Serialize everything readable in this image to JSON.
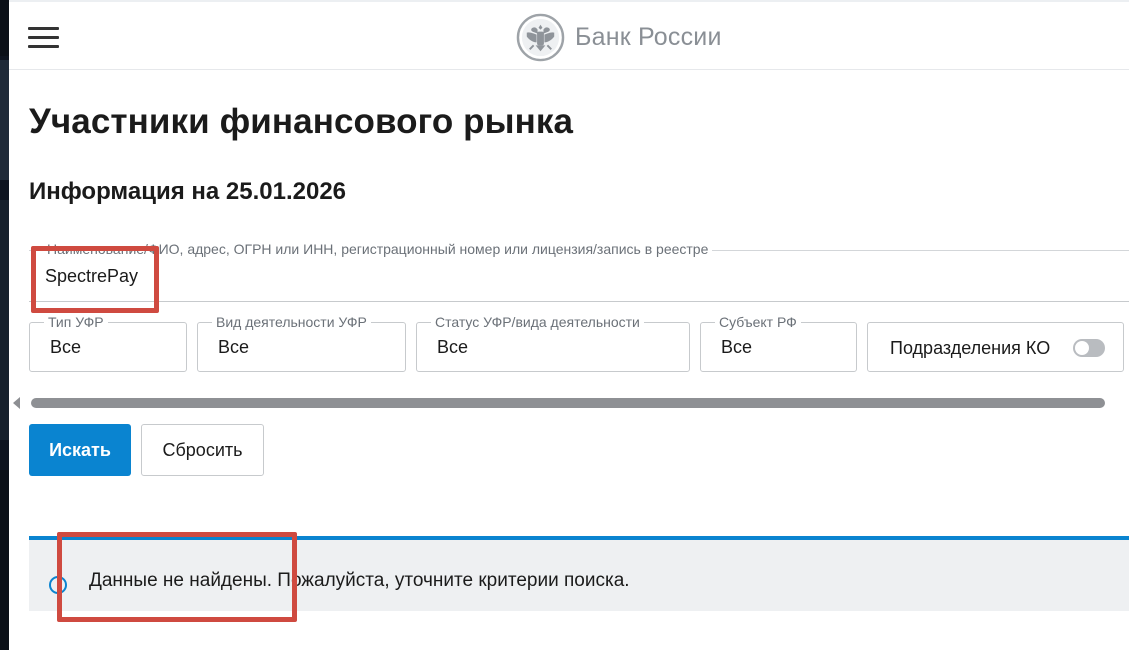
{
  "header": {
    "logo_text": "Банк России",
    "menu_icon": "hamburger-menu-icon",
    "emblem_icon": "double-headed-eagle-emblem-icon"
  },
  "page": {
    "title": "Участники финансового рынка",
    "info_date": "Информация на 25.01.2026"
  },
  "search": {
    "label": "Наименование/ФИО, адрес, ОГРН или ИНН, регистрационный номер или лицензия/запись в реестре",
    "value": "SpectrePay"
  },
  "filters": [
    {
      "label": "Тип УФР",
      "value": "Все"
    },
    {
      "label": "Вид деятельности УФР",
      "value": "Все"
    },
    {
      "label": "Статус УФР/вида деятельности",
      "value": "Все"
    },
    {
      "label": "Субъект РФ",
      "value": "Все"
    }
  ],
  "toggle": {
    "label": "Подразделения КО",
    "checked": false
  },
  "buttons": {
    "search": "Искать",
    "reset": "Сбросить"
  },
  "notice": {
    "text": "Данные не найдены. Пожалуйста, уточните критерии поиска.",
    "icon": "info-circle-icon"
  },
  "colors": {
    "accent": "#0a84d0",
    "highlight": "#cf4a40",
    "notice_bg": "#eef0f2"
  }
}
